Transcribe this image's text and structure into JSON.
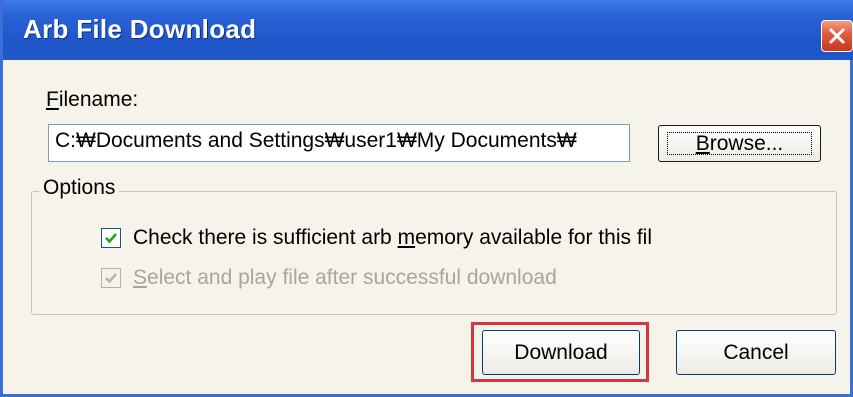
{
  "window": {
    "title": "Arb File Download"
  },
  "filename": {
    "label_first": "F",
    "label_rest": "ilename:",
    "value": "C:₩Documents and Settings₩user1₩My Documents₩"
  },
  "browse": {
    "label_first": "B",
    "label_rest": "rowse..."
  },
  "options": {
    "legend": "Options",
    "check_memory": {
      "checked": true,
      "enabled": true,
      "label_pre": "Check there is sufficient arb ",
      "label_mnemonic": "m",
      "label_post": "emory available for this fil"
    },
    "select_play": {
      "checked": true,
      "enabled": false,
      "label_mnemonic": "S",
      "label_post": "elect and play file after successful download"
    }
  },
  "buttons": {
    "download": "Download",
    "cancel": "Cancel"
  },
  "colors": {
    "titlebar": "#2a63d7",
    "close": "#e2573a",
    "highlight": "#d73442"
  },
  "icons": {
    "close": "close-icon",
    "checkmark": "checkmark-icon"
  }
}
